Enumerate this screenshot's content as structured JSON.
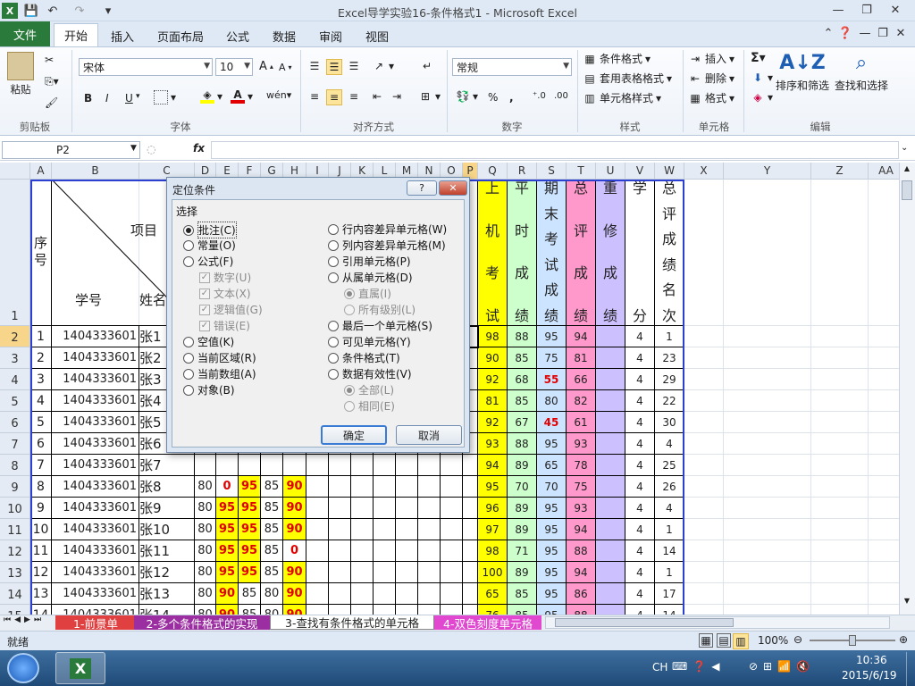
{
  "window": {
    "title": "Excel导学实验16-条件格式1 - Microsoft Excel"
  },
  "qat": {
    "save": "save-icon",
    "undo": "undo-icon",
    "redo": "redo-icon"
  },
  "tabs": {
    "file": "文件",
    "home": "开始",
    "insert": "插入",
    "layout": "页面布局",
    "formulas": "公式",
    "data": "数据",
    "review": "审阅",
    "view": "视图"
  },
  "ribbon": {
    "clipboard": {
      "label": "剪贴板",
      "paste": "粘贴"
    },
    "font": {
      "label": "字体",
      "name": "宋体",
      "size": "10",
      "bold": "B",
      "italic": "I",
      "underline": "U"
    },
    "alignment": {
      "label": "对齐方式"
    },
    "number": {
      "label": "数字",
      "format": "常规"
    },
    "styles": {
      "label": "样式",
      "cond": "条件格式",
      "table": "套用表格格式",
      "cell": "单元格样式"
    },
    "cells": {
      "label": "单元格",
      "insert": "插入",
      "delete": "删除",
      "format": "格式"
    },
    "editing": {
      "label": "编辑",
      "sort": "排序和筛选",
      "find": "查找和选择"
    }
  },
  "formula": {
    "namebox": "P2",
    "fx": "fx",
    "value": ""
  },
  "grid": {
    "columns": [
      "A",
      "B",
      "C",
      "D",
      "E",
      "F",
      "G",
      "H",
      "I",
      "J",
      "K",
      "L",
      "M",
      "N",
      "O",
      "P",
      "Q",
      "R",
      "S",
      "T",
      "U",
      "V",
      "W",
      "X",
      "Y",
      "Z",
      "AA"
    ],
    "selected_column": "P",
    "selected_row": "2",
    "rows": [
      "1",
      "2",
      "3",
      "4",
      "5",
      "6",
      "7",
      "8",
      "9",
      "10",
      "11",
      "12",
      "13",
      "14",
      "15"
    ],
    "header": {
      "seq": "序号",
      "item": "项目",
      "sid": "学号",
      "name": "姓名",
      "q": "上机考试",
      "r": "平时成绩",
      "s": "期末考试成绩",
      "t": "总评成绩",
      "u": "重修成绩",
      "v": "学分",
      "w": "总评成绩名次"
    },
    "data": [
      [
        "1",
        "1404333601",
        "张1",
        "",
        "",
        "",
        "",
        "",
        "98",
        "88",
        "95",
        "94",
        "",
        "4",
        "1"
      ],
      [
        "2",
        "1404333601",
        "张2",
        "",
        "",
        "",
        "",
        "",
        "90",
        "85",
        "75",
        "81",
        "",
        "4",
        "23"
      ],
      [
        "3",
        "1404333601",
        "张3",
        "",
        "",
        "",
        "",
        "",
        "92",
        "68",
        "55",
        "66",
        "",
        "4",
        "29"
      ],
      [
        "4",
        "1404333601",
        "张4",
        "",
        "",
        "",
        "",
        "",
        "81",
        "85",
        "80",
        "82",
        "",
        "4",
        "22"
      ],
      [
        "5",
        "1404333601",
        "张5",
        "",
        "",
        "",
        "",
        "",
        "92",
        "67",
        "45",
        "61",
        "",
        "4",
        "30"
      ],
      [
        "6",
        "1404333601",
        "张6",
        "",
        "",
        "",
        "",
        "",
        "93",
        "88",
        "95",
        "93",
        "",
        "4",
        "4"
      ],
      [
        "7",
        "1404333601",
        "张7",
        "",
        "",
        "",
        "",
        "",
        "94",
        "89",
        "65",
        "78",
        "",
        "4",
        "25"
      ],
      [
        "8",
        "1404333601",
        "张8",
        "80",
        "0",
        "95",
        "85",
        "90",
        "95",
        "70",
        "70",
        "75",
        "",
        "4",
        "26"
      ],
      [
        "9",
        "1404333601",
        "张9",
        "80",
        "95",
        "95",
        "85",
        "90",
        "96",
        "89",
        "95",
        "93",
        "",
        "4",
        "4"
      ],
      [
        "10",
        "1404333601",
        "张10",
        "80",
        "95",
        "95",
        "85",
        "90",
        "97",
        "89",
        "95",
        "94",
        "",
        "4",
        "1"
      ],
      [
        "11",
        "1404333601",
        "张11",
        "80",
        "95",
        "95",
        "85",
        "0",
        "98",
        "71",
        "95",
        "88",
        "",
        "4",
        "14"
      ],
      [
        "12",
        "1404333601",
        "张12",
        "80",
        "95",
        "95",
        "85",
        "90",
        "100",
        "89",
        "95",
        "94",
        "",
        "4",
        "1"
      ],
      [
        "13",
        "1404333601",
        "张13",
        "80",
        "90",
        "85",
        "80",
        "90",
        "65",
        "85",
        "95",
        "86",
        "",
        "4",
        "17"
      ],
      [
        "14",
        "1404333601",
        "张14",
        "80",
        "90",
        "85",
        "80",
        "90",
        "76",
        "85",
        "95",
        "88",
        "",
        "4",
        "14"
      ]
    ]
  },
  "dialog": {
    "title": "定位条件",
    "group": "选择",
    "left": [
      "批注(C)",
      "常量(O)",
      "公式(F)",
      "数字(U)",
      "文本(X)",
      "逻辑值(G)",
      "错误(E)",
      "空值(K)",
      "当前区域(R)",
      "当前数组(A)",
      "对象(B)"
    ],
    "right": [
      "行内容差异单元格(W)",
      "列内容差异单元格(M)",
      "引用单元格(P)",
      "从属单元格(D)",
      "直属(I)",
      "所有级别(L)",
      "最后一个单元格(S)",
      "可见单元格(Y)",
      "条件格式(T)",
      "数据有效性(V)",
      "全部(L)",
      "相同(E)"
    ],
    "ok": "确定",
    "cancel": "取消",
    "help": "?",
    "close": "✕"
  },
  "sheets": [
    "1-前景单",
    "2-多个条件格式的实现",
    "3-查找有条件格式的单元格",
    "4-双色刻度单元格"
  ],
  "status": {
    "ready": "就绪",
    "zoom": "100%"
  },
  "taskbar": {
    "ime": "CH",
    "time": "10:36",
    "date": "2015/6/19"
  },
  "colors": {
    "yellow": "#ffff00",
    "green": "#ccffcc",
    "blue": "#cce4ff",
    "pink": "#ff99cc",
    "purple": "#ccc0ff",
    "red": "#e00000",
    "border": "#2b3fd1"
  }
}
